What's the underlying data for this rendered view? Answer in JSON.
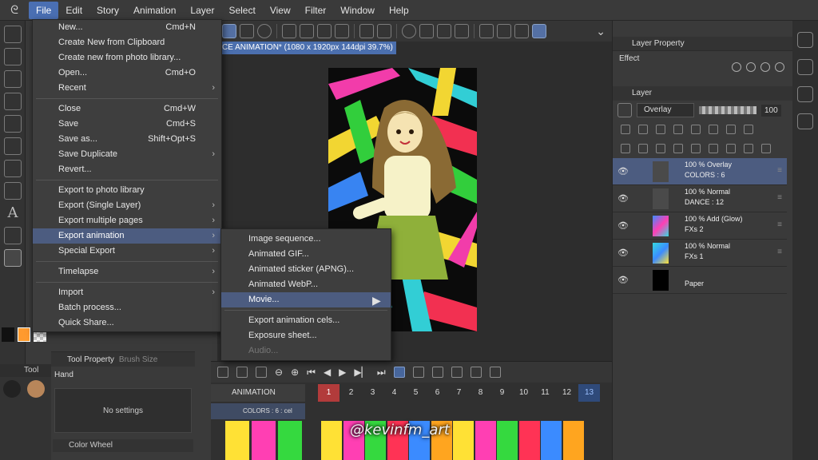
{
  "menubar": {
    "items": [
      "File",
      "Edit",
      "Story",
      "Animation",
      "Layer",
      "Select",
      "View",
      "Filter",
      "Window",
      "Help"
    ]
  },
  "file_menu": {
    "items": [
      {
        "label": "New...",
        "shortcut": "Cmd+N"
      },
      {
        "label": "Create New from Clipboard",
        "shortcut": ""
      },
      {
        "label": "Create new from photo library...",
        "shortcut": ""
      },
      {
        "label": "Open...",
        "shortcut": "Cmd+O"
      },
      {
        "label": "Recent",
        "shortcut": ""
      },
      {
        "label": "Close",
        "shortcut": "Cmd+W"
      },
      {
        "label": "Save",
        "shortcut": "Cmd+S"
      },
      {
        "label": "Save as...",
        "shortcut": "Shift+Opt+S"
      },
      {
        "label": "Save Duplicate",
        "shortcut": ""
      },
      {
        "label": "Revert...",
        "shortcut": ""
      },
      {
        "label": "Export to photo library",
        "shortcut": ""
      },
      {
        "label": "Export (Single Layer)",
        "shortcut": ""
      },
      {
        "label": "Export multiple pages",
        "shortcut": ""
      },
      {
        "label": "Export animation",
        "shortcut": ""
      },
      {
        "label": "Special Export",
        "shortcut": ""
      },
      {
        "label": "Timelapse",
        "shortcut": ""
      },
      {
        "label": "Import",
        "shortcut": ""
      },
      {
        "label": "Batch process...",
        "shortcut": ""
      },
      {
        "label": "Quick Share...",
        "shortcut": ""
      }
    ]
  },
  "export_submenu": {
    "items": [
      {
        "label": "Image sequence..."
      },
      {
        "label": "Animated GIF..."
      },
      {
        "label": "Animated sticker (APNG)..."
      },
      {
        "label": "Animated WebP..."
      },
      {
        "label": "Movie..."
      },
      {
        "label": "Export animation cels..."
      },
      {
        "label": "Exposure sheet..."
      },
      {
        "label": "Audio..."
      }
    ]
  },
  "canvas": {
    "tab_title": "CE ANIMATION* (1080 x 1920px 144dpi 39.7%)"
  },
  "tool_property": {
    "tab": "Tool Property",
    "tab2": "Brush Size",
    "tool_name": "Hand",
    "empty": "No settings",
    "color_wheel": "Color Wheel",
    "left_tab": "Tool"
  },
  "timeline": {
    "track_name": "ANIMATION",
    "layer_label": "COLORS : 6 : cel",
    "frames": [
      "1",
      "2",
      "3",
      "4",
      "5",
      "6",
      "7",
      "8",
      "9",
      "10",
      "11",
      "12",
      "13"
    ],
    "current_frame_marker": "0",
    "playhead_frame": "1",
    "end_marker_a": "1",
    "end_marker_b": "1",
    "cel_colors": [
      "#ffe135",
      "#ff3fb3",
      "#35d93f",
      "#ff3355",
      "#3b8bff",
      "#ffa51f",
      "#ffe135",
      "#ff3fb3",
      "#35d93f",
      "#ff3355",
      "#3b8bff",
      "#ffa51f"
    ],
    "left_cel_colors": [
      "#ffe135",
      "#ff3fb3",
      "#35d93f"
    ]
  },
  "right_panel": {
    "layer_property_tab": "Layer Property",
    "effect_label": "Effect",
    "layer_tab": "Layer",
    "blend_mode": "Overlay",
    "opacity": "100",
    "layers": [
      {
        "line1": "100 % Overlay",
        "line2": "COLORS : 6",
        "selected": true
      },
      {
        "line1": "100 % Normal",
        "line2": "DANCE : 12",
        "selected": false
      },
      {
        "line1": "100 % Add (Glow)",
        "line2": "FXs 2",
        "selected": false
      },
      {
        "line1": "100 % Normal",
        "line2": "FXs 1",
        "selected": false
      },
      {
        "line1": "",
        "line2": "Paper",
        "selected": false
      }
    ]
  },
  "watermark": "@kevinfm_art",
  "colors": {
    "accent": "#4b6fae",
    "menu_highlight": "#4c5c80",
    "playhead": "#b23b3b",
    "swatch_main": "#ff9a2e"
  }
}
